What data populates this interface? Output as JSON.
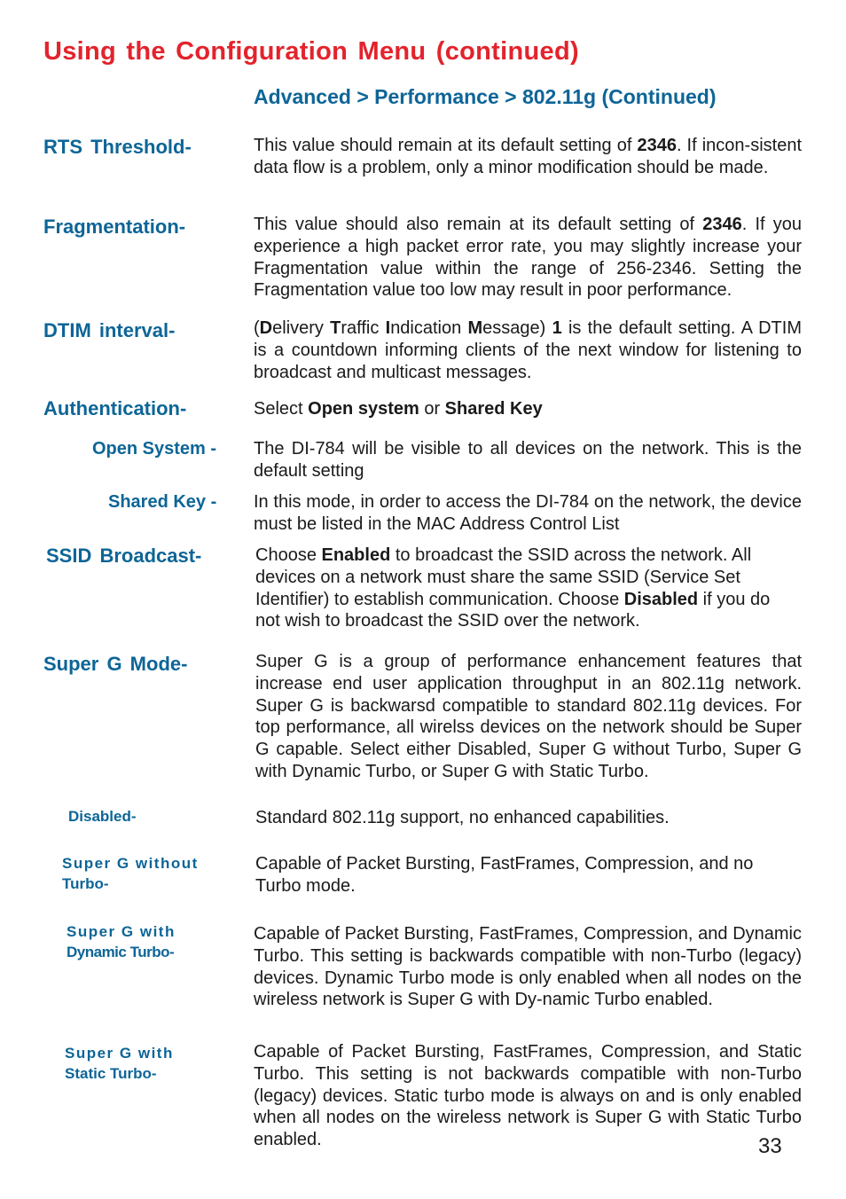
{
  "page": {
    "title": "Using the Configuration Menu (continued)",
    "breadcrumb": "Advanced > Performance > 802.11g (Continued)",
    "page_number": "33"
  },
  "colors": {
    "title": "#e3232c",
    "label": "#0d6597",
    "body": "#1a1a1a"
  },
  "sections": [
    {
      "label": "RTS Threshold-",
      "segments": [
        {
          "t": "This value should remain at its  default setting of "
        },
        {
          "t": "2346",
          "b": true
        },
        {
          "t": ". If incon-sistent data flow is a problem, only a minor modification should be made."
        }
      ]
    },
    {
      "label": "Fragmentation-",
      "segments": [
        {
          "t": "This value should also remain at its default setting of "
        },
        {
          "t": "2346",
          "b": true
        },
        {
          "t": ". If you experience a high packet error rate, you may slightly increase your Fragmentation value within the range of 256-2346. Setting the Fragmentation value too low may result in poor performance."
        }
      ]
    },
    {
      "label": "DTIM interval-",
      "segments": [
        {
          "t": "("
        },
        {
          "t": "D",
          "b": true
        },
        {
          "t": "elivery "
        },
        {
          "t": "T",
          "b": true
        },
        {
          "t": "raffic "
        },
        {
          "t": "I",
          "b": true
        },
        {
          "t": "ndication "
        },
        {
          "t": "M",
          "b": true
        },
        {
          "t": "essage) "
        },
        {
          "t": "1",
          "b": true
        },
        {
          "t": " is the default setting. A DTIM is a countdown informing clients of the next window for listening to broadcast and multicast messages."
        }
      ]
    },
    {
      "label": "Authentication-",
      "segments": [
        {
          "t": "Select "
        },
        {
          "t": "Open system",
          "b": true
        },
        {
          "t": " or "
        },
        {
          "t": "Shared Key",
          "b": true
        }
      ]
    },
    {
      "label": "Open System -",
      "segments": [
        {
          "t": "The DI-784 will be visible to all devices on the network. This is the default setting"
        }
      ]
    },
    {
      "label": "Shared Key -",
      "segments": [
        {
          "t": "In this mode, in order to access the DI-784 on the network, the device must be listed in the MAC Address Control List"
        }
      ]
    },
    {
      "label": "SSID Broadcast-",
      "segments": [
        {
          "t": "Choose "
        },
        {
          "t": "Enabled",
          "b": true
        },
        {
          "t": " to broadcast the SSID across the network. All devices on a network must share the same SSID (Service Set Identifier) to establish communication. Choose "
        },
        {
          "t": "Disabled",
          "b": true
        },
        {
          "t": " if you do not wish to broadcast the SSID over the network."
        }
      ]
    },
    {
      "label": "Super G Mode-",
      "segments": [
        {
          "t": "Super G is a group of performance enhancement features that increase end user application throughput in an 802.11g network. Super G is backwarsd compatible to standard 802.11g devices. For top performance, all wirelss devices on the network should be Super G capable. Select either Disabled, Super G without Turbo, Super G with Dynamic Turbo, or Super G with Static Turbo."
        }
      ]
    },
    {
      "label": "Disabled-",
      "segments": [
        {
          "t": "Standard 802.11g support, no enhanced capabilities."
        }
      ]
    },
    {
      "label_line1": "Super G without",
      "label_line2": "Turbo-",
      "segments": [
        {
          "t": "Capable of Packet Bursting, FastFrames, Compression, and no Turbo mode."
        }
      ]
    },
    {
      "label_line1": "Super G with",
      "label_line2": "Dynamic Turbo-",
      "segments": [
        {
          "t": "Capable of Packet Bursting, FastFrames, Compression, and Dynamic Turbo. This setting is backwards compatible with non-Turbo (legacy) devices. Dynamic Turbo mode is only enabled when all nodes on the wireless network is Super G with Dy-namic Turbo enabled."
        }
      ]
    },
    {
      "label_line1": "Super G with",
      "label_line2": "Static Turbo-",
      "segments": [
        {
          "t": "Capable of Packet Bursting, FastFrames, Compression, and Static Turbo. This setting is not backwards compatible with non-Turbo (legacy) devices. Static turbo mode is always on and is only enabled when all nodes on the wireless network is Super G with Static Turbo enabled."
        }
      ]
    }
  ]
}
